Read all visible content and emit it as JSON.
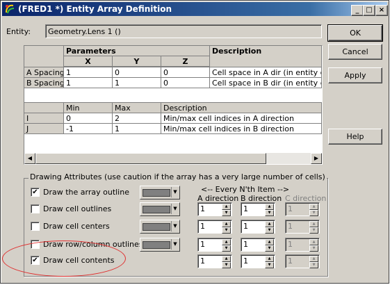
{
  "window": {
    "title": "(FRED1 *) Entity Array Definition",
    "min": "_",
    "max": "□",
    "close": "×"
  },
  "entity": {
    "label": "Entity:",
    "value": "Geometry.Lens 1   ()"
  },
  "buttons": {
    "ok": "OK",
    "cancel": "Cancel",
    "apply": "Apply",
    "help": "Help"
  },
  "grid": {
    "params_header": "Parameters",
    "desc_header": "Description",
    "cols": [
      "X",
      "Y",
      "Z"
    ],
    "rows": [
      {
        "label": "A Spacing",
        "x": "1",
        "y": "0",
        "z": "0",
        "desc": "Cell space in A dir (in entity coord"
      },
      {
        "label": "B Spacing",
        "x": "1",
        "y": "1",
        "z": "0",
        "desc": "Cell space in B dir (in entity coord"
      }
    ],
    "range_headers": [
      "Min",
      "Max",
      "Description"
    ],
    "ranges": [
      {
        "label": "I",
        "min": "0",
        "max": "2",
        "desc": "Min/max cell indices in A direction"
      },
      {
        "label": "J",
        "min": "-1",
        "max": "1",
        "desc": "Min/max cell indices in B direction"
      }
    ]
  },
  "drawing": {
    "title": "Drawing Attributes (use caution if the array has a very large number of cells)",
    "every_nth": "<-- Every N'th Item -->",
    "col_a": "A direction",
    "col_b": "B direction",
    "col_c": "C direction",
    "items": [
      {
        "label": "Draw the array outline",
        "checked": true
      },
      {
        "label": "Draw cell outlines",
        "checked": false
      },
      {
        "label": "Draw cell centers",
        "checked": false
      },
      {
        "label": "Draw row/column outlines",
        "checked": false
      },
      {
        "label": "Draw cell contents",
        "checked": true
      }
    ],
    "a_values": [
      "1",
      "1",
      "1",
      "1"
    ],
    "b_values": [
      "1",
      "1",
      "1",
      "1"
    ],
    "c_values": [
      "1",
      "1",
      "1",
      "1"
    ],
    "swatch_color": "#808080",
    "highlight_color": "#e03030"
  }
}
